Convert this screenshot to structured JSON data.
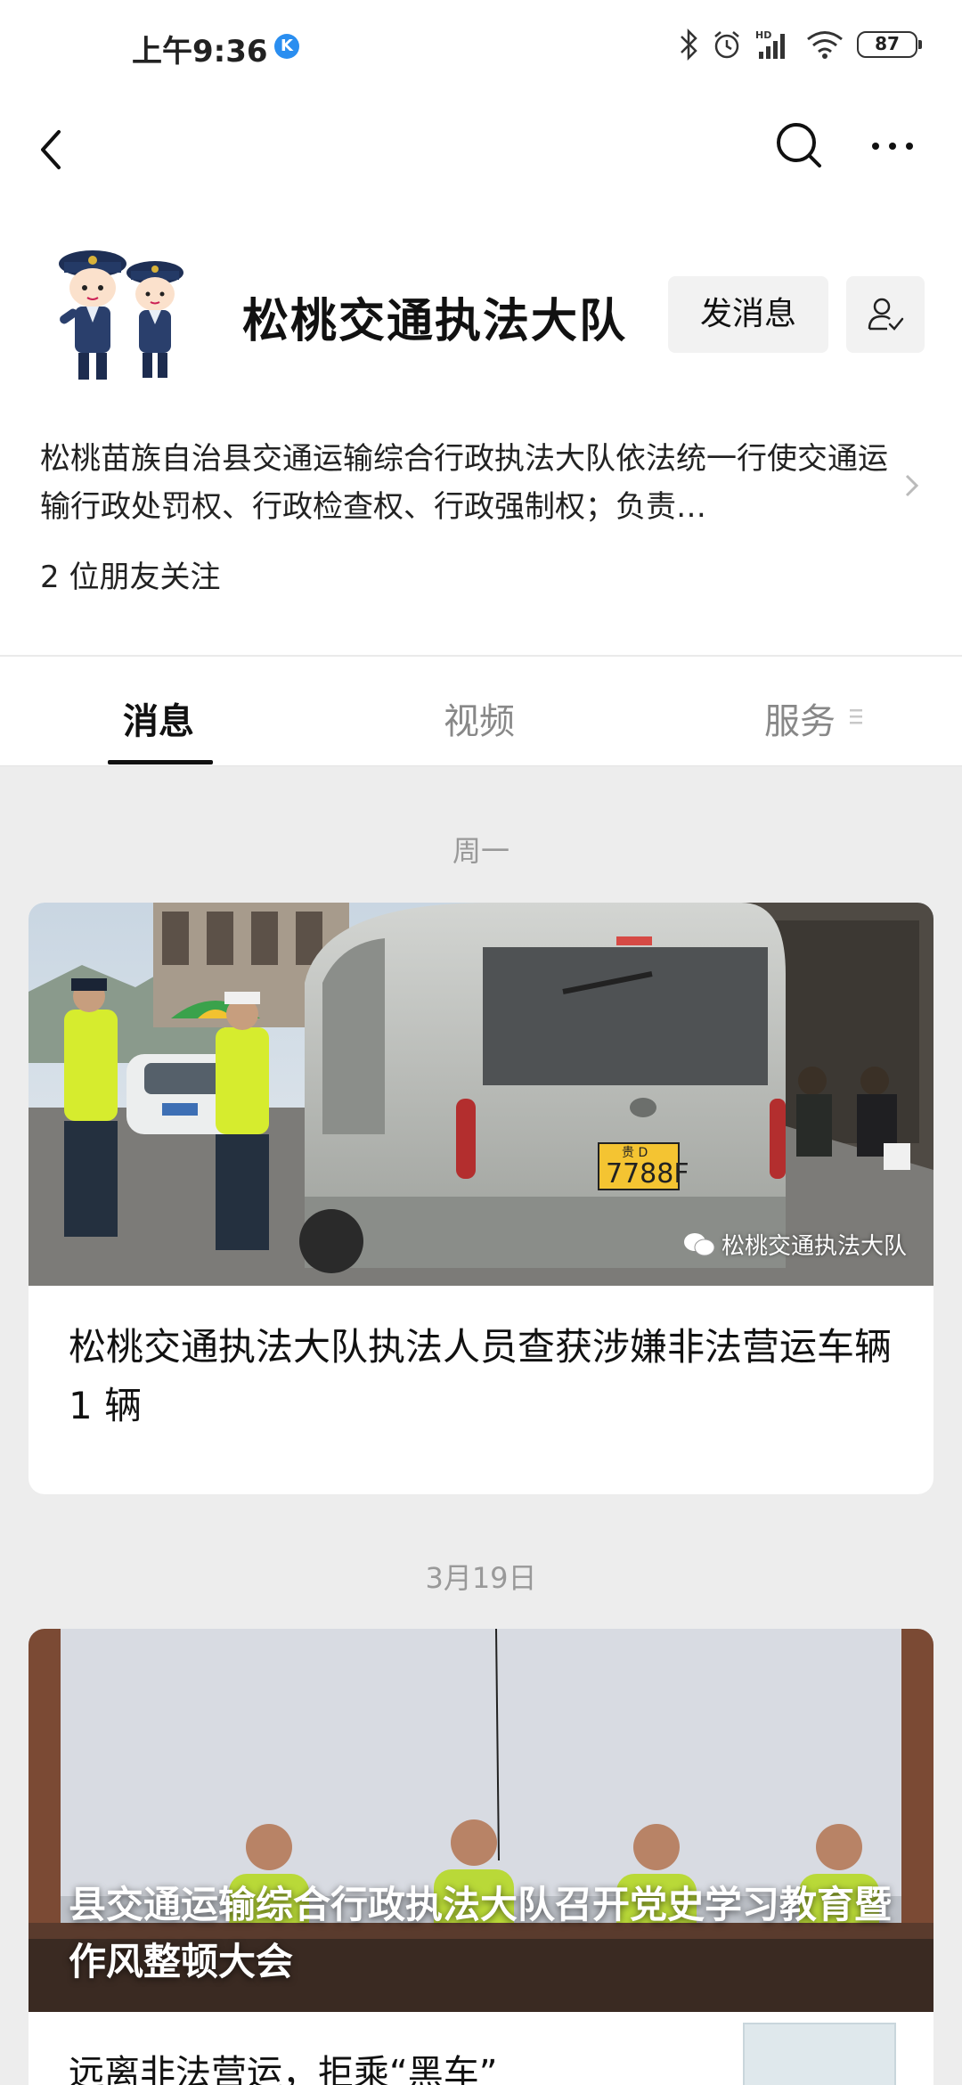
{
  "status_bar": {
    "time": "上午9:36",
    "k_badge": "K",
    "battery": "87"
  },
  "profile": {
    "name": "松桃交通执法大队",
    "message_button": "发消息",
    "description": "松桃苗族自治县交通运输综合行政执法大队依法统一行使交通运输行政处罚权、行政检查权、行政强制权；负责…",
    "followers": "2 位朋友关注"
  },
  "tabs": [
    {
      "label": "消息",
      "active": true
    },
    {
      "label": "视频",
      "active": false
    },
    {
      "label": "服务",
      "active": false
    }
  ],
  "feed": [
    {
      "date": "周一",
      "title": "松桃交通执法大队执法人员查获涉嫌非法营运车辆 1 辆",
      "watermark": "松桃交通执法大队",
      "plate": "7788F",
      "plate_prefix": "贵 D"
    },
    {
      "date": "3月19日",
      "overlay_title": "县交通运输综合行政执法大队召开党史学习教育暨作风整顿大会",
      "sub_item_title": "远离非法营运，拒乘“黑车”"
    }
  ],
  "colors": {
    "background": "#ededed",
    "card": "#ffffff",
    "accent_k": "#2a8ef0"
  }
}
